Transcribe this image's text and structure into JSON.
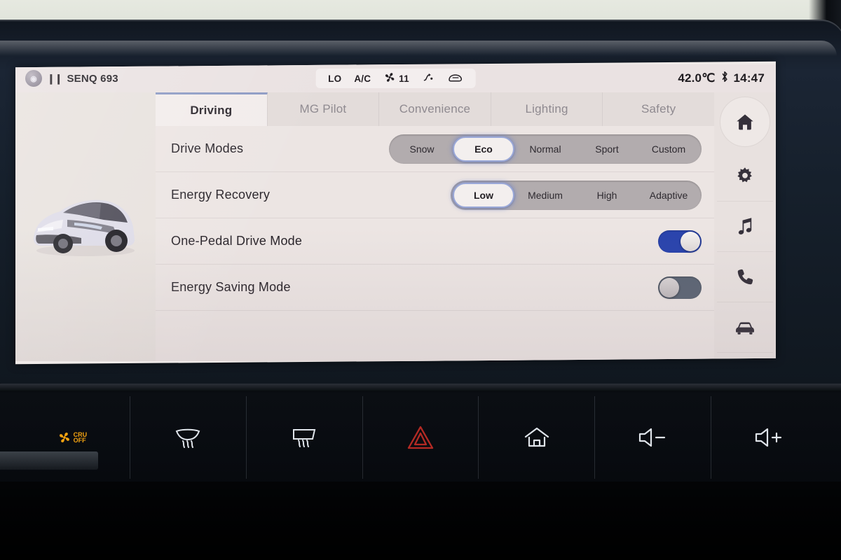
{
  "status_bar": {
    "media_badge": "cd-icon",
    "pause_icon": "pause-icon",
    "track_name": "SENQ 693",
    "climate": {
      "temp_mode": "LO",
      "ac_label": "A/C",
      "fan_icon": "fan-icon",
      "fan_speed": "11",
      "airflow_icon": "airflow-icon",
      "seat_icon": "seat-icon"
    },
    "outside_temp": "42.0℃",
    "bluetooth_icon": "bluetooth-icon",
    "clock": "14:47"
  },
  "tabs": [
    {
      "label": "Driving",
      "active": true
    },
    {
      "label": "MG Pilot",
      "active": false
    },
    {
      "label": "Convenience",
      "active": false
    },
    {
      "label": "Lighting",
      "active": false
    },
    {
      "label": "Safety",
      "active": false
    }
  ],
  "vehicle_image": {
    "name": "mg-ev-hatchback-render",
    "body_color": "#d8d6e2"
  },
  "settings_rows": [
    {
      "label": "Drive Modes",
      "type": "segmented",
      "options": [
        "Snow",
        "Eco",
        "Normal",
        "Sport",
        "Custom"
      ],
      "selected": "Eco"
    },
    {
      "label": "Energy Recovery",
      "type": "segmented",
      "options": [
        "Low",
        "Medium",
        "High",
        "Adaptive"
      ],
      "selected": "Low"
    },
    {
      "label": "One-Pedal Drive Mode",
      "type": "toggle",
      "state": "on"
    },
    {
      "label": "Energy Saving Mode",
      "type": "toggle",
      "state": "off"
    }
  ],
  "side_rail": [
    {
      "name": "home-icon",
      "label": "Home"
    },
    {
      "name": "gear-icon",
      "label": "Settings"
    },
    {
      "name": "music-icon",
      "label": "Media"
    },
    {
      "name": "phone-icon",
      "label": "Phone"
    },
    {
      "name": "car-icon",
      "label": "Vehicle"
    }
  ],
  "hard_keys": [
    {
      "name": "recirculation-off-button",
      "text_line1": "CRU",
      "text_line2": "OFF",
      "color": "#f4a310"
    },
    {
      "name": "front-defrost-button",
      "text_line1": "",
      "text_line2": "",
      "color": "#dfe4ea"
    },
    {
      "name": "rear-defrost-button",
      "text_line1": "",
      "text_line2": "",
      "color": "#dfe4ea"
    },
    {
      "name": "hazard-lights-button",
      "text_line1": "",
      "text_line2": "",
      "color": "#b32a24"
    },
    {
      "name": "home-button",
      "text_line1": "",
      "text_line2": "",
      "color": "#dfe4ea"
    },
    {
      "name": "volume-down-button",
      "text_line1": "",
      "text_line2": "",
      "color": "#dfe4ea"
    },
    {
      "name": "volume-up-button",
      "text_line1": "",
      "text_line2": "",
      "color": "#dfe4ea"
    }
  ],
  "colors": {
    "accent_blue": "#2a44ad",
    "selected_outline": "#9aa8d8",
    "screen_bg": "#ece5e3",
    "bezel": "#1b2534",
    "hazard_red": "#b32a24",
    "recirc_amber": "#f4a310"
  }
}
